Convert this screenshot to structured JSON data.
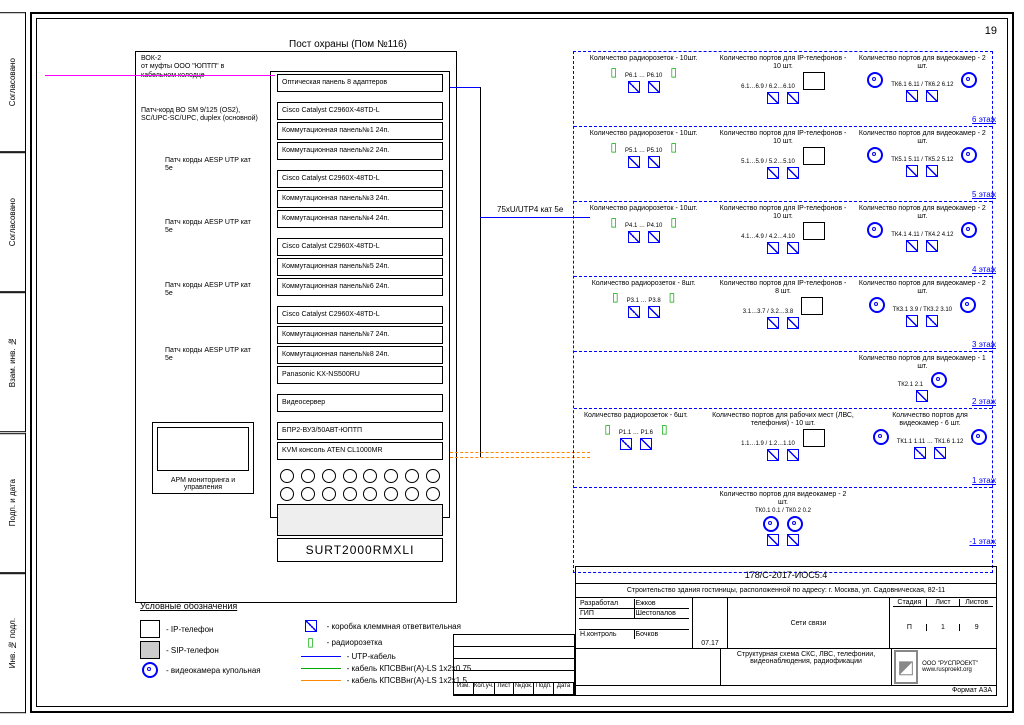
{
  "page_number": "19",
  "side_tabs": [
    "Согласовано",
    "Согласовано",
    "Взам. инв. №",
    "Подп. и дата",
    "Инв. № подл."
  ],
  "rack": {
    "title": "Пост охраны (Пом №116)",
    "items": [
      "Оптическая панель 8 адаптеров",
      "Cisco Catalyst C2960X-48TD-L",
      "Коммутационная панель№1 24п.",
      "Коммутационная панель№2 24п.",
      "Cisco Catalyst C2960X-48TD-L",
      "Коммутационная панель№3 24п.",
      "Коммутационная панель№4 24п.",
      "Cisco Catalyst C2960X-48TD-L",
      "Коммутационная панель№5 24п.",
      "Коммутационная панель№6 24п.",
      "Cisco Catalyst C2960X-48TD-L",
      "Коммутационная панель№7 24п.",
      "Коммутационная панель№8 24п.",
      "Panasonic KX-NS500RU",
      "Видеосервер",
      "БПР2-ВУЗ/50АВТ-ЮПТП",
      "KVM консоль ATEN CL1000MR"
    ],
    "ups_label": "SURT2000RMXLI",
    "arm_label": "АРМ мониторинга и управления"
  },
  "annotations": {
    "vok": "ВОК-2\nот муфты ООО \"ЮПТП\" в кабельном колодце",
    "patch_fiber": "Патч-корд ВО SM 9/125 (OS2), SC/UPC-SC/UPC, duplex (основной)",
    "aesp1": "Патч корды AESP UTP кат 5e",
    "aesp2": "Патч корды AESP UTP кат 5e",
    "aesp3": "Патч корды AESP UTP кат 5e",
    "aesp4": "Патч корды AESP UTP кат 5e",
    "backbone": "75xU/UTP4 кат 5e"
  },
  "floors": [
    {
      "name": "6 этаж",
      "radio": "Количество радиорозеток - 10шт.",
      "radio_ports": "Р6.1 … Р6.10",
      "ip": "Количество портов для IP-телефонов - 10 шт.",
      "ip_ports": "6.1…6.9 / 6.2…6.10",
      "cam": "Количество портов для видеокамер - 2 шт.",
      "cam_ports": "ТК6.1 6.11 / ТК6.2 6.12"
    },
    {
      "name": "5 этаж",
      "radio": "Количество радиорозеток - 10шт.",
      "radio_ports": "Р5.1 … Р5.10",
      "ip": "Количество портов для IP-телефонов - 10 шт.",
      "ip_ports": "5.1…5.9 / 5.2…5.10",
      "cam": "Количество портов для видеокамер - 2 шт.",
      "cam_ports": "ТК5.1 5.11 / ТК5.2 5.12"
    },
    {
      "name": "4 этаж",
      "radio": "Количество радиорозеток - 10шт.",
      "radio_ports": "Р4.1 … Р4.10",
      "ip": "Количество портов для IP-телефонов - 10 шт.",
      "ip_ports": "4.1…4.9 / 4.2…4.10",
      "cam": "Количество портов для видеокамер - 2 шт.",
      "cam_ports": "ТК4.1 4.11 / ТК4.2 4.12"
    },
    {
      "name": "3 этаж",
      "radio": "Количество радиорозеток - 8шт.",
      "radio_ports": "Р3.1 … Р3.8",
      "ip": "Количество портов для IP-телефонов - 8 шт.",
      "ip_ports": "3.1…3.7 / 3.2…3.8",
      "cam": "Количество портов для видеокамер - 2 шт.",
      "cam_ports": "ТК3.1 3.9 / ТК3.2 3.10"
    },
    {
      "name": "2 этаж",
      "cam_only": "Количество портов для видеокамер - 1 шт.",
      "cam_ports": "ТК2.1 2.1"
    },
    {
      "name": "1 этаж",
      "radio": "Количество радиорозеток - 6шт.",
      "radio_ports": "Р1.1 … Р1.6",
      "ip": "Количество портов для рабочих мест (ЛВС, телефония) - 10 шт.",
      "ip_ports": "1.1…1.9 / 1.2…1.10",
      "cam": "Количество портов для видеокамер - 6 шт.",
      "cam_ports": "ТК1.1 1.11 … ТК1.6 1.12"
    },
    {
      "name": "-1 этаж",
      "cam_only": "Количество портов для видеокамер - 2 шт.",
      "cam_ports": "ТК0.1 0.1 / ТК0.2 0.2"
    }
  ],
  "legend": {
    "title": "Условные обозначения",
    "left": [
      {
        "label": "- IP-телефон"
      },
      {
        "label": "- SIP-телефон"
      },
      {
        "label": "- видеокамера купольная"
      }
    ],
    "right": [
      {
        "label": "- коробка клеммная ответвительная"
      },
      {
        "label": "- радиорозетка"
      },
      {
        "label": "- UTP-кабель",
        "color": "#00f"
      },
      {
        "label": "- кабель КПСВВнг(А)-LS 1x2x0.75",
        "color": "#0a0"
      },
      {
        "label": "- кабель КПСВВнг(А)-LS 1x2x1.5",
        "color": "#f80"
      }
    ]
  },
  "title_block": {
    "code": "178/С-2017-ИОС5.4",
    "project": "Строительство здания гостиницы, расположенной по адресу: г. Москва, ул. Садовническая, 82-11",
    "system": "Сети связи",
    "sheet_title": "Структурная схема СКС, ЛВС, телефонии, видеонаблюдения, радиофикации",
    "company": "ООО \"РУСПРОЕКТ\" www.rusproekt.org",
    "format": "Формат А3А",
    "stage_h": "Стадия",
    "sheet_h": "Лист",
    "sheets_h": "Листов",
    "stage": "П",
    "sheet": "1",
    "sheets": "9",
    "roles": {
      "dev": "Разработал",
      "dev_n": "Ежков",
      "gip": "ГИП",
      "gip_n": "Шестопалов",
      "nk": "Н.контроль",
      "nk_n": "Бочков",
      "date": "07.17"
    },
    "rev_h": [
      "Изм.",
      "Кол.уч.",
      "Лист",
      "№док.",
      "Подп.",
      "Дата"
    ]
  }
}
